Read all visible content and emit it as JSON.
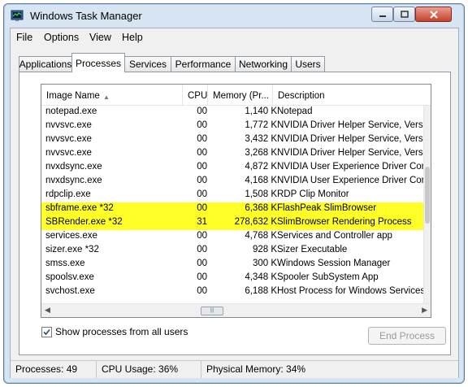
{
  "window": {
    "title": "Windows Task Manager"
  },
  "menu": [
    "File",
    "Options",
    "View",
    "Help"
  ],
  "tabs": [
    "Applications",
    "Processes",
    "Services",
    "Performance",
    "Networking",
    "Users"
  ],
  "active_tab": "Processes",
  "columns": {
    "image_name": "Image Name",
    "cpu": "CPU",
    "memory": "Memory (Pr...",
    "description": "Description"
  },
  "processes": [
    {
      "name": "notepad.exe",
      "cpu": "00",
      "memory": "1,140 K",
      "description": "Notepad"
    },
    {
      "name": "nvvsvc.exe",
      "cpu": "00",
      "memory": "1,772 K",
      "description": "NVIDIA Driver Helper Service, Version ..."
    },
    {
      "name": "nvvsvc.exe",
      "cpu": "00",
      "memory": "3,432 K",
      "description": "NVIDIA Driver Helper Service, Version ..."
    },
    {
      "name": "nvvsvc.exe",
      "cpu": "00",
      "memory": "3,268 K",
      "description": "NVIDIA Driver Helper Service, Version ..."
    },
    {
      "name": "nvxdsync.exe",
      "cpu": "00",
      "memory": "4,872 K",
      "description": "NVIDIA User Experience Driver Compo..."
    },
    {
      "name": "nvxdsync.exe",
      "cpu": "00",
      "memory": "4,168 K",
      "description": "NVIDIA User Experience Driver Compo..."
    },
    {
      "name": "rdpclip.exe",
      "cpu": "00",
      "memory": "1,508 K",
      "description": "RDP Clip Monitor"
    },
    {
      "name": "sbframe.exe *32",
      "cpu": "00",
      "memory": "6,368 K",
      "description": "FlashPeak SlimBrowser"
    },
    {
      "name": "SBRender.exe *32",
      "cpu": "31",
      "memory": "278,632 K",
      "description": "SlimBrowser Rendering Process"
    },
    {
      "name": "services.exe",
      "cpu": "00",
      "memory": "4,768 K",
      "description": "Services and Controller app"
    },
    {
      "name": "sizer.exe *32",
      "cpu": "00",
      "memory": "928 K",
      "description": "Sizer Executable"
    },
    {
      "name": "smss.exe",
      "cpu": "00",
      "memory": "300 K",
      "description": "Windows Session Manager"
    },
    {
      "name": "spoolsv.exe",
      "cpu": "00",
      "memory": "4,348 K",
      "description": "Spooler SubSystem App"
    },
    {
      "name": "svchost.exe",
      "cpu": "00",
      "memory": "6,188 K",
      "description": "Host Process for Windows Services"
    }
  ],
  "highlighted_rows": [
    "sbframe.exe *32",
    "SBRender.exe *32"
  ],
  "highlight_color": "#ffff27",
  "show_all_users": {
    "label": "Show processes from all users",
    "checked": true
  },
  "end_process_label": "End Process",
  "status": {
    "processes": "Processes: 49",
    "cpu_usage": "CPU Usage: 36%",
    "physical_memory": "Physical Memory: 34%"
  }
}
